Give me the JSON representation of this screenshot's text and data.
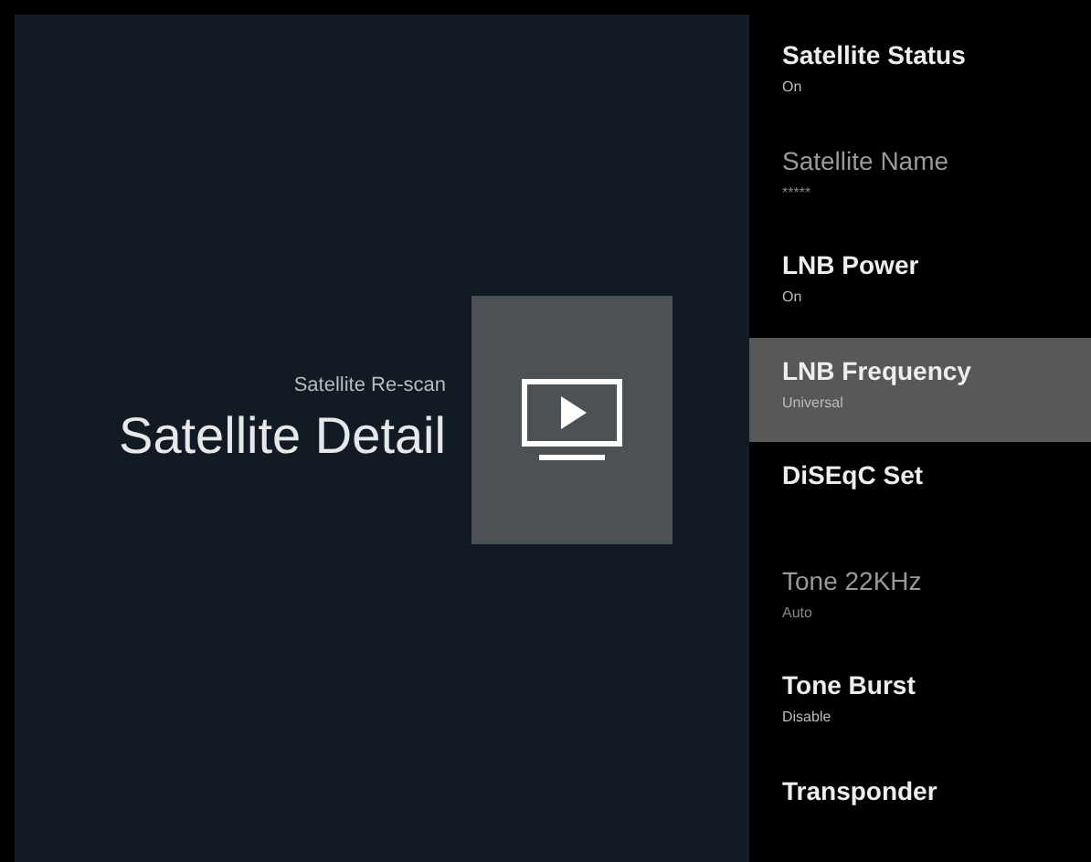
{
  "header": {
    "breadcrumb": "Satellite Re-scan",
    "title": "Satellite Detail"
  },
  "menu": [
    {
      "label": "Satellite Status",
      "value": "On",
      "disabled": false,
      "selected": false
    },
    {
      "label": "Satellite Name",
      "value": "*****",
      "disabled": true,
      "selected": false
    },
    {
      "label": "LNB Power",
      "value": "On",
      "disabled": false,
      "selected": false
    },
    {
      "label": "LNB Frequency",
      "value": "Universal",
      "disabled": false,
      "selected": true
    },
    {
      "label": "DiSEqC Set",
      "disabled": false,
      "selected": false
    },
    {
      "label": "Tone 22KHz",
      "value": "Auto",
      "disabled": true,
      "selected": false
    },
    {
      "label": "Tone Burst",
      "value": "Disable",
      "disabled": false,
      "selected": false
    },
    {
      "label": "Transponder",
      "disabled": false,
      "selected": false
    }
  ]
}
